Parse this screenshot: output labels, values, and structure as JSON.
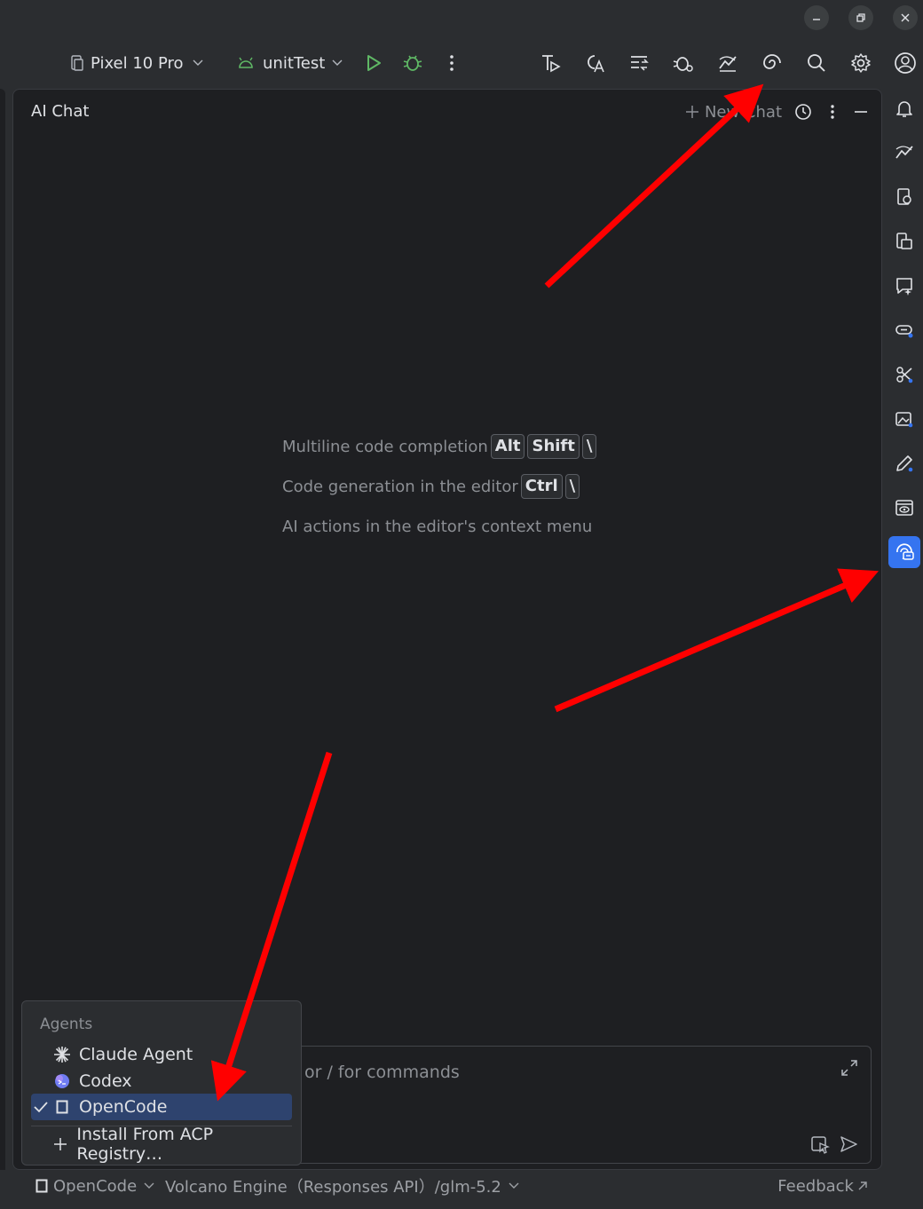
{
  "window": {
    "minimize_label": "minimize",
    "restore_label": "restore",
    "close_label": "close"
  },
  "toolbar": {
    "device": "Pixel 10 Pro",
    "run_config": "unitTest"
  },
  "chat": {
    "title": "AI Chat",
    "new_chat_label": "New Chat",
    "hints": [
      {
        "text": "Multiline code completion",
        "keys": [
          "Alt",
          "Shift",
          "\\"
        ]
      },
      {
        "text": "Code generation in the editor",
        "keys": [
          "Ctrl",
          "\\"
        ]
      },
      {
        "text": "AI actions in the editor's context menu",
        "keys": []
      }
    ],
    "input_placeholder": "or / for commands"
  },
  "agents_popup": {
    "header": "Agents",
    "items": [
      {
        "label": "Claude Agent",
        "icon": "claude-spark-icon",
        "selected": false
      },
      {
        "label": "Codex",
        "icon": "codex-icon",
        "selected": false
      },
      {
        "label": "OpenCode",
        "icon": "opencode-icon",
        "selected": true
      }
    ],
    "install_label": "Install From ACP Registry…"
  },
  "status_bar": {
    "agent": "OpenCode",
    "provider": "Volcano Engine（Responses API）/glm-5.2",
    "feedback": "Feedback"
  },
  "colors": {
    "accent": "#3574f0",
    "selected_row": "#2e436e",
    "annotation_arrow": "#ff0000",
    "run_green": "#5fb865"
  }
}
